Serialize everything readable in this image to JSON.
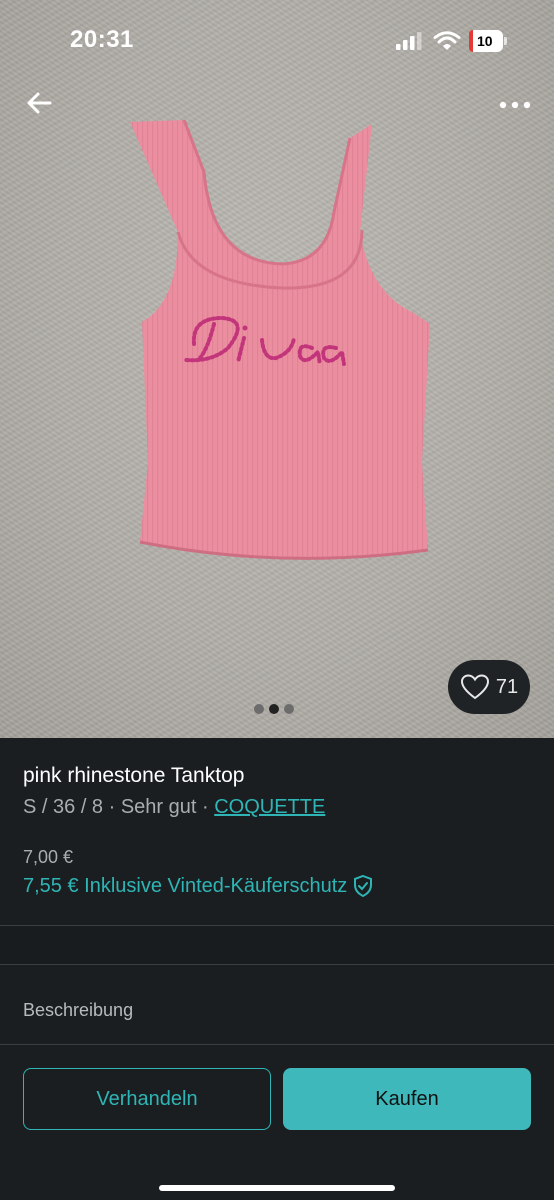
{
  "status_bar": {
    "time": "20:31",
    "battery": "10"
  },
  "listing": {
    "photo_count": 3,
    "active_photo": 2,
    "likes": "71",
    "title": "pink rhinestone Tanktop",
    "meta_prefix": "S / 36 / 8 · Sehr gut · ",
    "brand": "COQUETTE",
    "price": "7,00 €",
    "price_with_protection": "7,55 € Inklusive Vinted-Käuferschutz"
  },
  "sections": {
    "description_label": "Beschreibung"
  },
  "actions": {
    "negotiate": "Verhandeln",
    "buy": "Kaufen"
  },
  "colors": {
    "accent": "#2fb5b5",
    "buy_button": "#3fb8bb",
    "background": "#1b1e21",
    "tank_pink": "#ea8fa0"
  },
  "icons": [
    "back-arrow-icon",
    "more-dots-icon",
    "heart-icon",
    "shield-check-icon",
    "signal-icon",
    "wifi-icon",
    "battery-icon"
  ]
}
